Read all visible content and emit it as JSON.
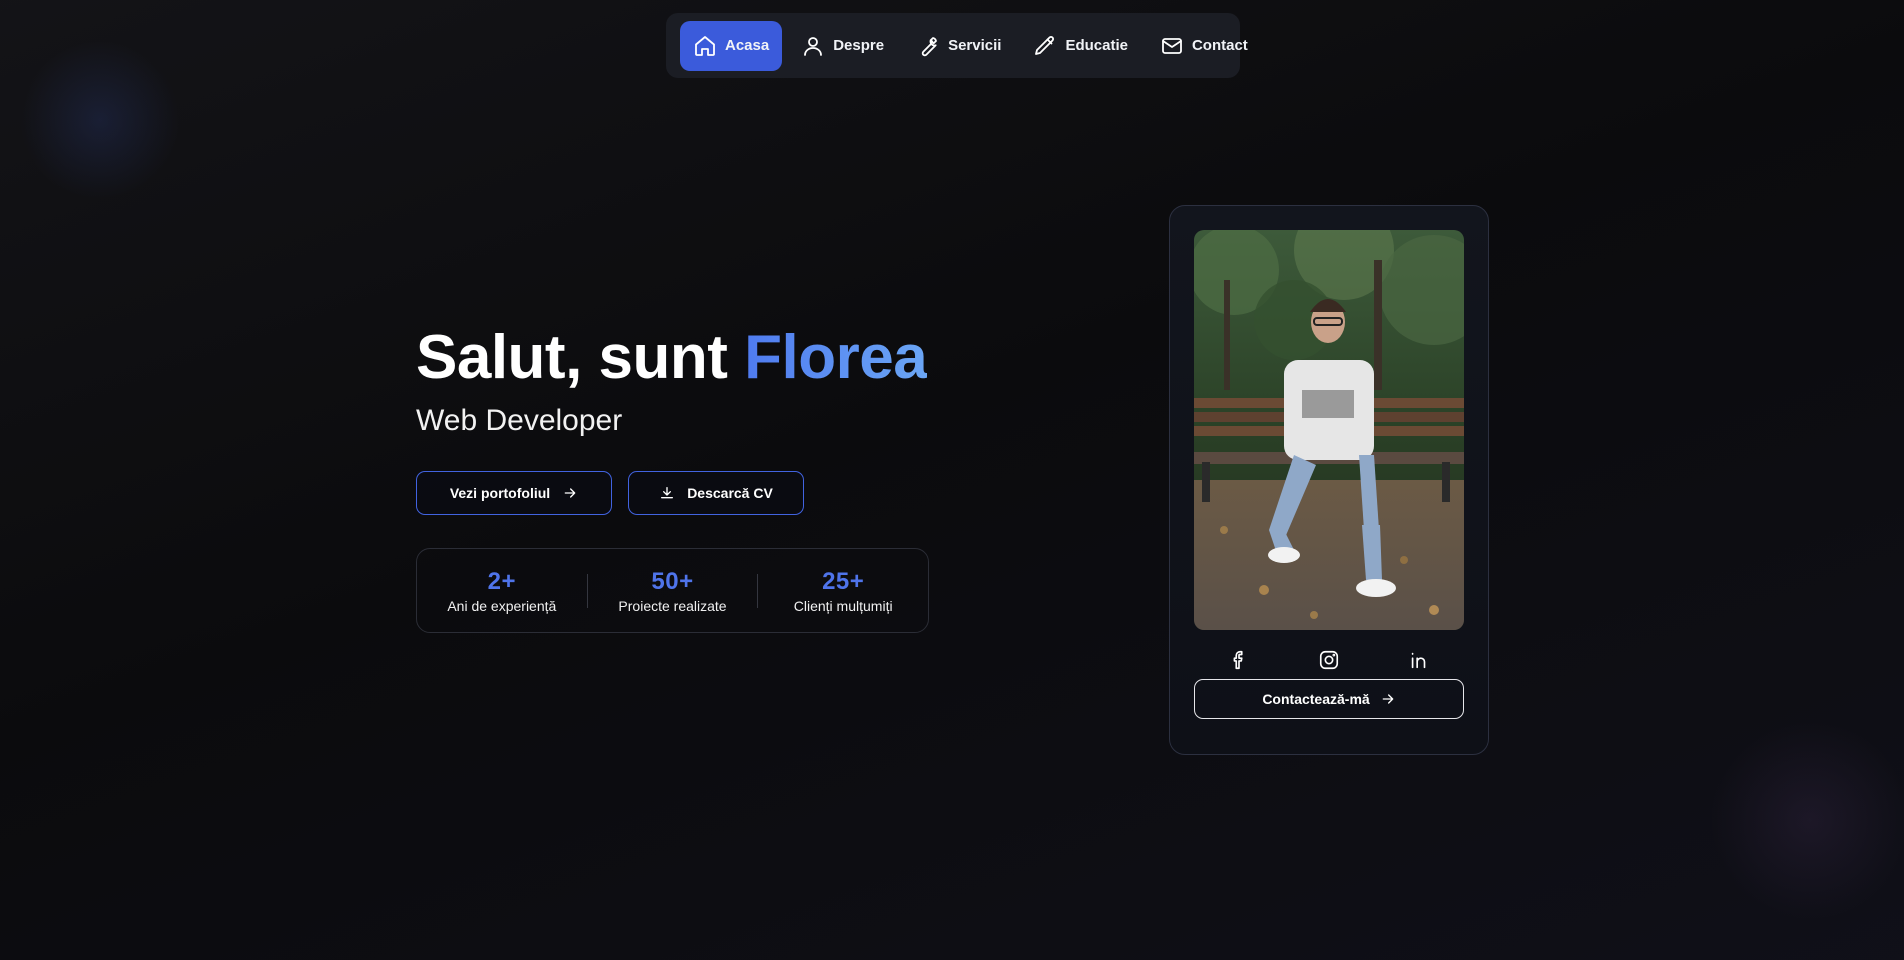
{
  "nav": {
    "items": [
      {
        "label": "Acasa",
        "icon": "home-icon",
        "active": true
      },
      {
        "label": "Despre",
        "icon": "user-icon",
        "active": false
      },
      {
        "label": "Servicii",
        "icon": "wrench-icon",
        "active": false
      },
      {
        "label": "Educatie",
        "icon": "pencil-icon",
        "active": false
      },
      {
        "label": "Contact",
        "icon": "mail-icon",
        "active": false
      }
    ]
  },
  "hero": {
    "greeting": "Salut, sunt ",
    "name": "Florea",
    "role": "Web Developer",
    "portfolio_button": "Vezi portofoliul",
    "cv_button": "Descarcă CV"
  },
  "stats": [
    {
      "value": "2+",
      "label": "Ani de experiență"
    },
    {
      "value": "50+",
      "label": "Proiecte realizate"
    },
    {
      "value": "25+",
      "label": "Clienți mulțumiți"
    }
  ],
  "profile_card": {
    "social": [
      "facebook-icon",
      "instagram-icon",
      "linkedin-icon"
    ],
    "contact_button": "Contactează-mă"
  },
  "colors": {
    "accent": "#3b5bdb",
    "accent_text": "#4f74ea",
    "background": "#0b0b0d",
    "nav_background": "#1b1d24"
  }
}
